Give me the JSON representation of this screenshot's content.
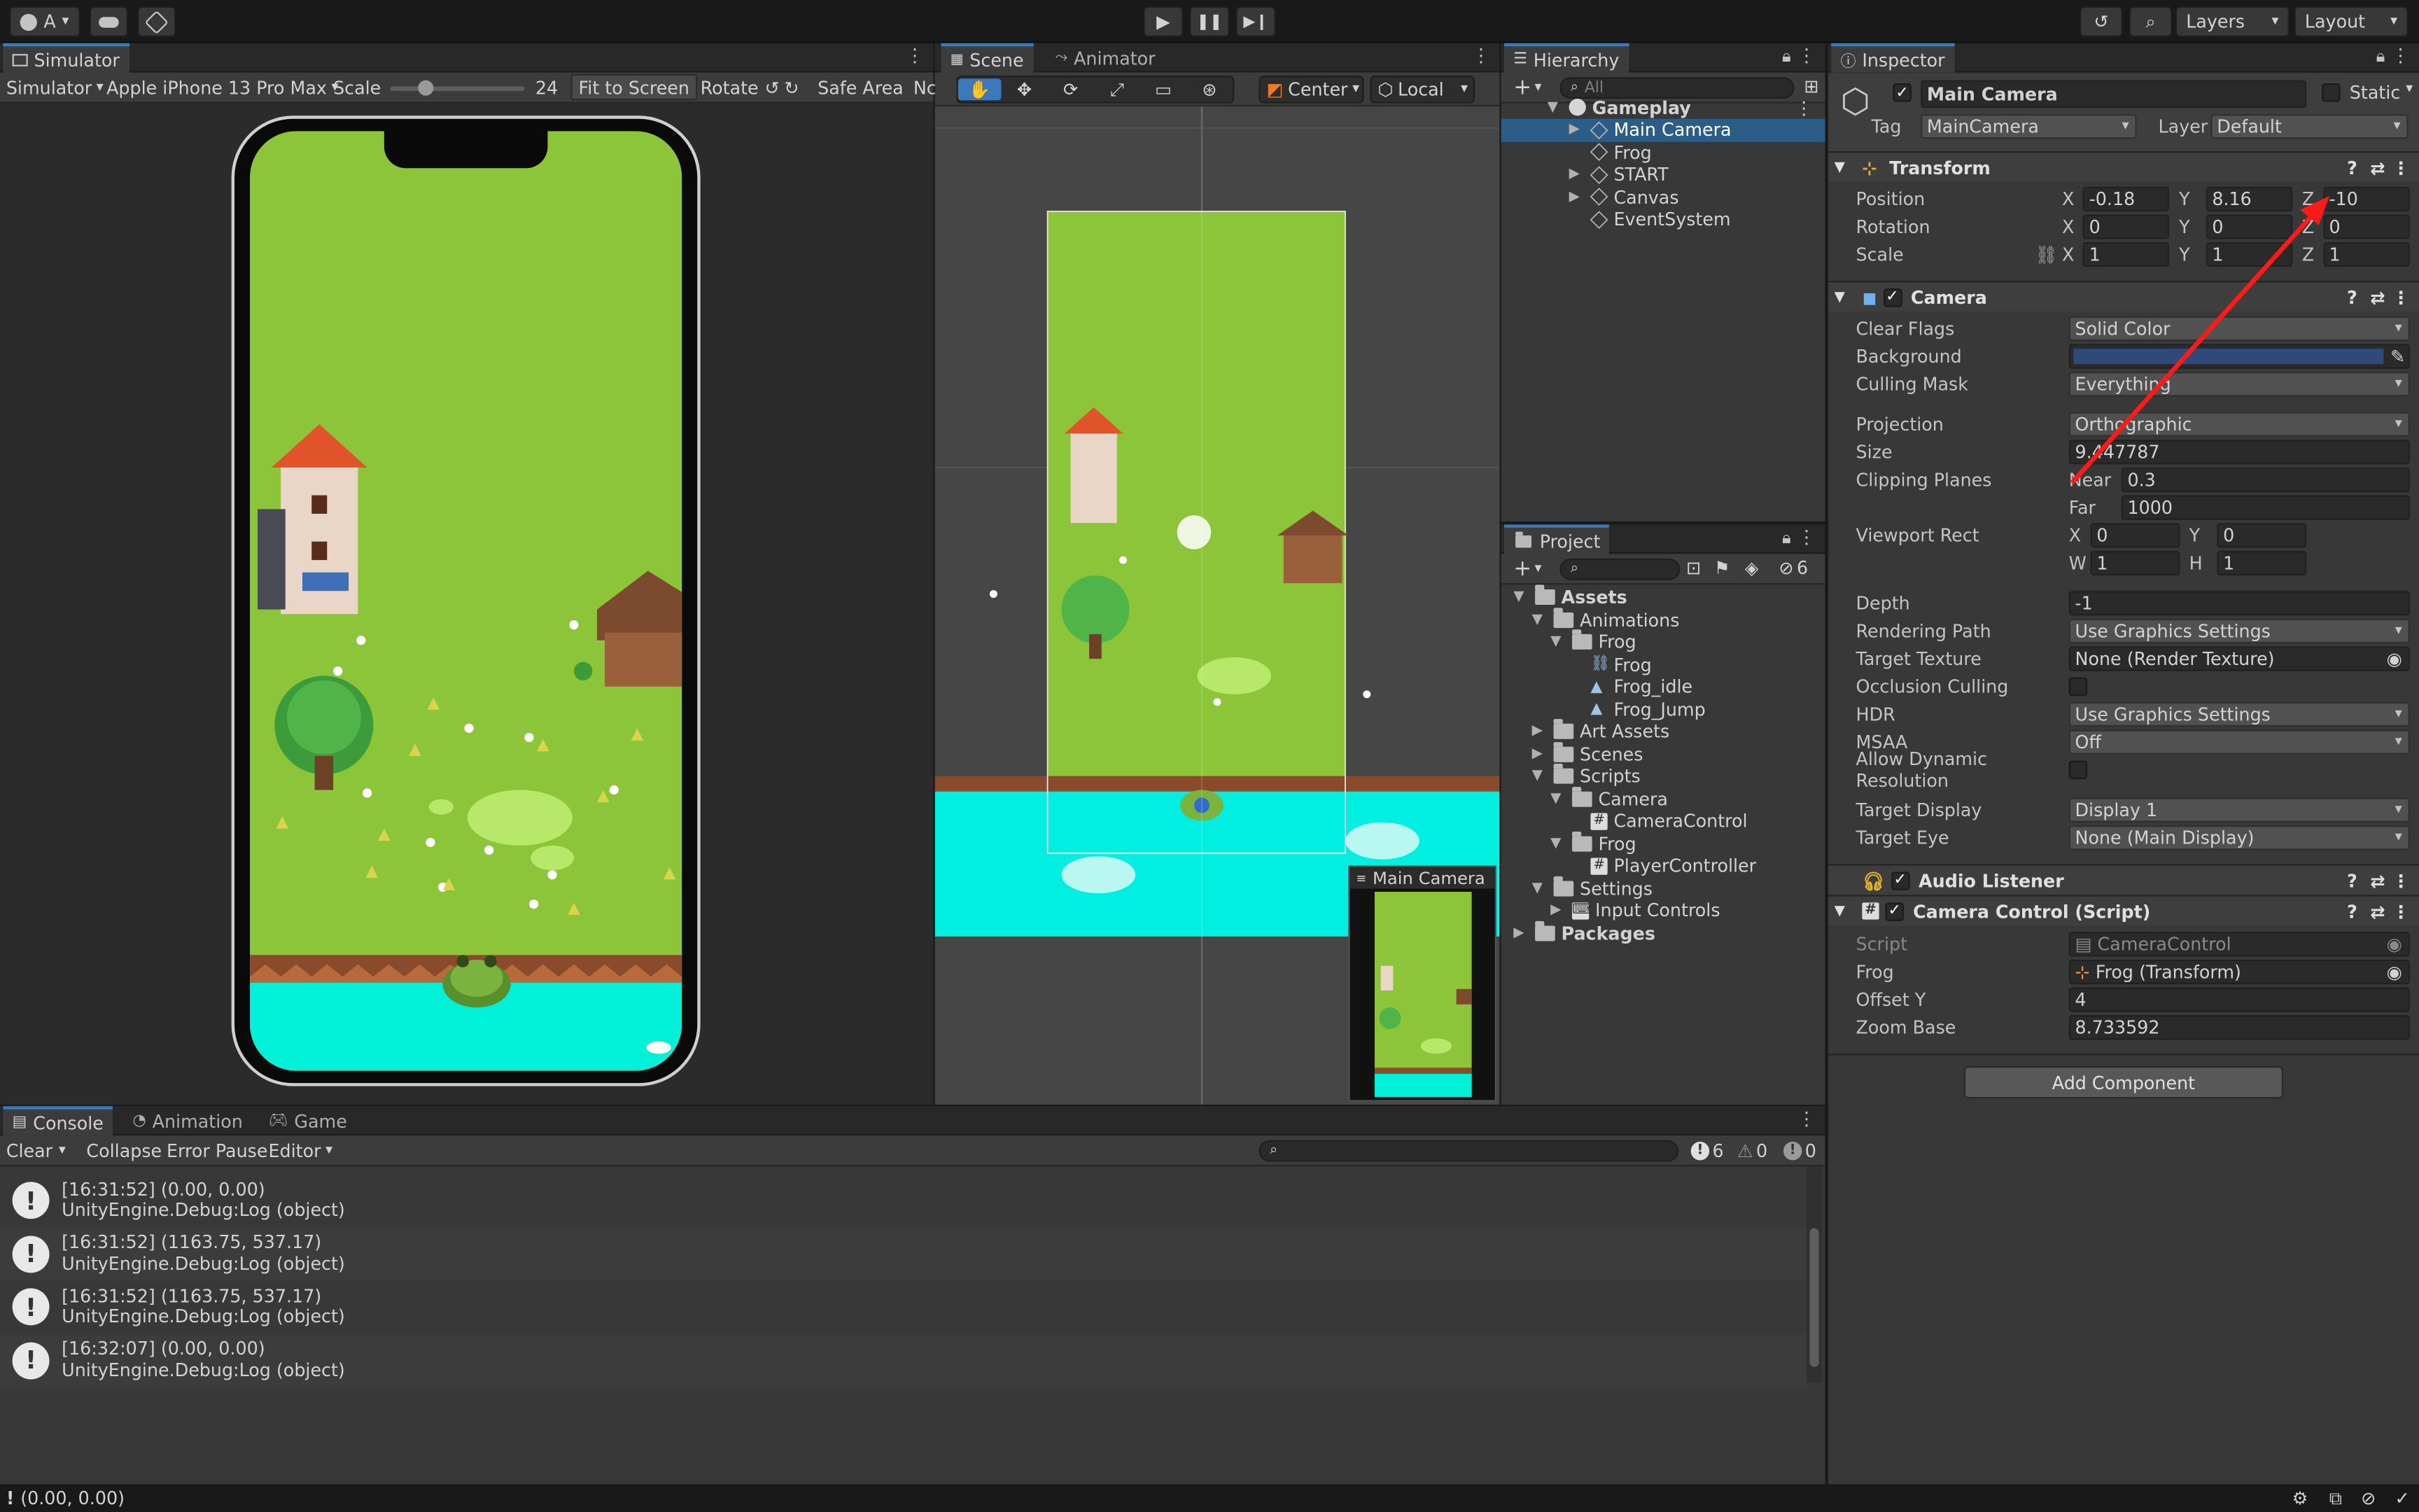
{
  "toolbar": {
    "account": "A",
    "layers": "Layers",
    "layout": "Layout"
  },
  "simulator": {
    "tab": "Simulator",
    "mode": "Simulator",
    "device": "Apple iPhone 13 Pro Max",
    "scale_label": "Scale",
    "scale_value": "24",
    "scale_fraction": 0.27,
    "fit": "Fit to Screen",
    "rotate": "Rotate",
    "safe_area": "Safe Area",
    "extra": "Nc"
  },
  "scene": {
    "tab_scene": "Scene",
    "tab_animator": "Animator",
    "pivot": "Center",
    "space": "Local",
    "camera_preview_title": "Main Camera"
  },
  "hierarchy": {
    "tab": "Hierarchy",
    "search_placeholder": "All",
    "root": "Gameplay",
    "items": [
      "Main Camera",
      "Frog",
      "START",
      "Canvas",
      "EventSystem"
    ]
  },
  "project": {
    "tab": "Project",
    "hidden_count": "6",
    "tree": [
      {
        "label": "Assets",
        "depth": 0,
        "type": "folder",
        "open": true,
        "bold": true
      },
      {
        "label": "Animations",
        "depth": 1,
        "type": "folder",
        "open": true
      },
      {
        "label": "Frog",
        "depth": 2,
        "type": "folder",
        "open": true
      },
      {
        "label": "Frog",
        "depth": 3,
        "type": "controller"
      },
      {
        "label": "Frog_idle",
        "depth": 3,
        "type": "anim"
      },
      {
        "label": "Frog_Jump",
        "depth": 3,
        "type": "anim"
      },
      {
        "label": "Art Assets",
        "depth": 1,
        "type": "folder",
        "open": false
      },
      {
        "label": "Scenes",
        "depth": 1,
        "type": "folder",
        "open": false
      },
      {
        "label": "Scripts",
        "depth": 1,
        "type": "folder",
        "open": true
      },
      {
        "label": "Camera",
        "depth": 2,
        "type": "folder",
        "open": true
      },
      {
        "label": "CameraControl",
        "depth": 3,
        "type": "script"
      },
      {
        "label": "Frog",
        "depth": 2,
        "type": "folder",
        "open": true
      },
      {
        "label": "PlayerController",
        "depth": 3,
        "type": "script"
      },
      {
        "label": "Settings",
        "depth": 1,
        "type": "folder",
        "open": true
      },
      {
        "label": "Input Controls",
        "depth": 2,
        "type": "input",
        "open": false
      },
      {
        "label": "Packages",
        "depth": 0,
        "type": "folder",
        "open": false,
        "bold": true
      }
    ]
  },
  "inspector": {
    "tab": "Inspector",
    "object_name": "Main Camera",
    "static_label": "Static",
    "tag_label": "Tag",
    "tag_value": "MainCamera",
    "layer_label": "Layer",
    "layer_value": "Default",
    "transform": {
      "title": "Transform",
      "position_label": "Position",
      "pos_x": "-0.18",
      "pos_y": "8.16",
      "pos_z": "-10",
      "rotation_label": "Rotation",
      "rot_x": "0",
      "rot_y": "0",
      "rot_z": "0",
      "scale_label": "Scale",
      "sc_x": "1",
      "sc_y": "1",
      "sc_z": "1"
    },
    "camera": {
      "title": "Camera",
      "clear_flags_label": "Clear Flags",
      "clear_flags": "Solid Color",
      "background_label": "Background",
      "background_color": "#2f4a78",
      "culling_label": "Culling Mask",
      "culling": "Everything",
      "projection_label": "Projection",
      "projection": "Orthographic",
      "size_label": "Size",
      "size": "9.447787",
      "clipping_label": "Clipping Planes",
      "near_label": "Near",
      "near": "0.3",
      "far_label": "Far",
      "far": "1000",
      "viewport_label": "Viewport Rect",
      "vx": "0",
      "vy": "0",
      "vw": "1",
      "vh": "1",
      "depth_label": "Depth",
      "depth": "-1",
      "rendering_label": "Rendering Path",
      "rendering": "Use Graphics Settings",
      "target_texture_label": "Target Texture",
      "target_texture": "None (Render Texture)",
      "occlusion_label": "Occlusion Culling",
      "hdr_label": "HDR",
      "hdr": "Use Graphics Settings",
      "msaa_label": "MSAA",
      "msaa": "Off",
      "dynres_label": "Allow Dynamic Resolution",
      "target_display_label": "Target Display",
      "target_display": "Display 1",
      "target_eye_label": "Target Eye",
      "target_eye": "None (Main Display)"
    },
    "audio_listener": "Audio Listener",
    "camera_control": {
      "title": "Camera Control (Script)",
      "script_label": "Script",
      "script": "CameraControl",
      "frog_label": "Frog",
      "frog": "Frog (Transform)",
      "offset_label": "Offset Y",
      "offset": "4",
      "zoom_label": "Zoom Base",
      "zoom": "8.733592"
    },
    "add_component": "Add Component"
  },
  "console": {
    "tabs": [
      "Console",
      "Animation",
      "Game"
    ],
    "clear": "Clear",
    "collapse": "Collapse",
    "error_pause": "Error Pause",
    "editor": "Editor",
    "count_log": "6",
    "count_warn": "0",
    "count_error": "0",
    "entries": [
      {
        "line1": "[16:31:52] (0.00, 0.00)",
        "line2": "UnityEngine.Debug:Log (object)"
      },
      {
        "line1": "[16:31:52] (1163.75, 537.17)",
        "line2": "UnityEngine.Debug:Log (object)"
      },
      {
        "line1": "[16:31:52] (1163.75, 537.17)",
        "line2": "UnityEngine.Debug:Log (object)"
      },
      {
        "line1": "[16:32:07] (0.00, 0.00)",
        "line2": "UnityEngine.Debug:Log (object)"
      }
    ]
  },
  "status_bar": {
    "message": "(0.00, 0.00)"
  }
}
